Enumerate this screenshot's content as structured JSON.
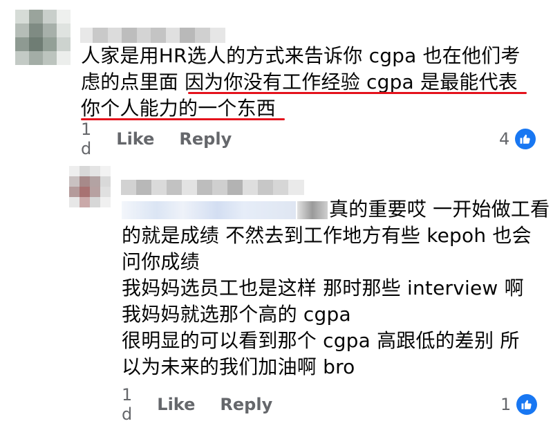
{
  "comment1": {
    "body_lines": [
      "人家是用HR选人的方式来告诉你 cgpa 也在他们考",
      "虑的点里面 因为你没有工作经验 cgpa 是最能代表",
      "你个人能力的一个东西"
    ],
    "time": "1 d",
    "like_label": "Like",
    "reply_label": "Reply",
    "reaction_count": "4"
  },
  "comment2": {
    "body_lines": [
      "真的重要哎 一开始做工看",
      "的就是成绩 不然去到工作地方有些 kepoh 也会",
      "问你成绩",
      "我妈妈选员工也是这样 那时那些 interview 啊",
      "我妈妈就选那个高的 cgpa",
      "很明显的可以看到那个 cgpa 高跟低的差别 所",
      "以为未来的我们加油啊 bro"
    ],
    "time": "1 d",
    "like_label": "Like",
    "reply_label": "Reply",
    "reaction_count": "1"
  },
  "colors": {
    "underline": "#e4121c",
    "like_badge": "#1877f2",
    "meta_text": "#65676b"
  },
  "icons": {
    "reaction": "thumbs-up-icon"
  }
}
